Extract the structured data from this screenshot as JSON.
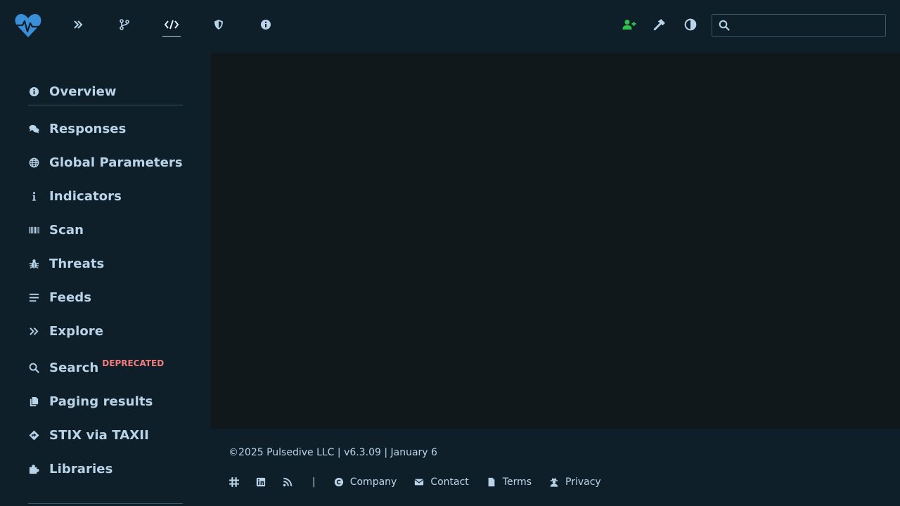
{
  "header": {
    "search_placeholder": "",
    "nav": [
      {
        "name": "explore",
        "icon": "double-chevron-icon"
      },
      {
        "name": "branch",
        "icon": "code-branch-icon"
      },
      {
        "name": "api",
        "icon": "code-icon",
        "active": true
      },
      {
        "name": "security",
        "icon": "shield-icon"
      },
      {
        "name": "info",
        "icon": "info-circle-icon"
      }
    ],
    "right_icons": [
      "add-user-icon",
      "hammer-icon",
      "contrast-icon"
    ]
  },
  "sidebar": {
    "items": [
      {
        "label": "Overview",
        "icon": "info-circle-icon"
      },
      {
        "label": "Responses",
        "icon": "comments-icon"
      },
      {
        "label": "Global Parameters",
        "icon": "globe-icon"
      },
      {
        "label": "Indicators",
        "icon": "info-icon"
      },
      {
        "label": "Scan",
        "icon": "barcode-icon"
      },
      {
        "label": "Threats",
        "icon": "bug-icon"
      },
      {
        "label": "Feeds",
        "icon": "list-icon"
      },
      {
        "label": "Explore",
        "icon": "double-chevron-icon"
      },
      {
        "label": "Search",
        "icon": "search-icon",
        "badge": "DEPRECATED"
      },
      {
        "label": "Paging results",
        "icon": "copy-icon"
      },
      {
        "label": "STIX via TAXII",
        "icon": "diamond-arrow-icon"
      },
      {
        "label": "Libraries",
        "icon": "puzzle-icon"
      }
    ]
  },
  "footer": {
    "copyright": "©2025 Pulsedive LLC | v6.3.09 | January 6",
    "separator": "|",
    "links": [
      {
        "label": "Company",
        "icon": "copyright-icon"
      },
      {
        "label": "Contact",
        "icon": "envelope-icon"
      },
      {
        "label": "Terms",
        "icon": "file-icon"
      },
      {
        "label": "Privacy",
        "icon": "user-secret-icon"
      }
    ]
  },
  "colors": {
    "background": "#0f1f2a",
    "panel": "#11181c",
    "text": "#b9d4e8",
    "accent_green": "#2ec24a",
    "badge_red": "#f07c7c",
    "logo_blue": "#3a8fd8"
  }
}
